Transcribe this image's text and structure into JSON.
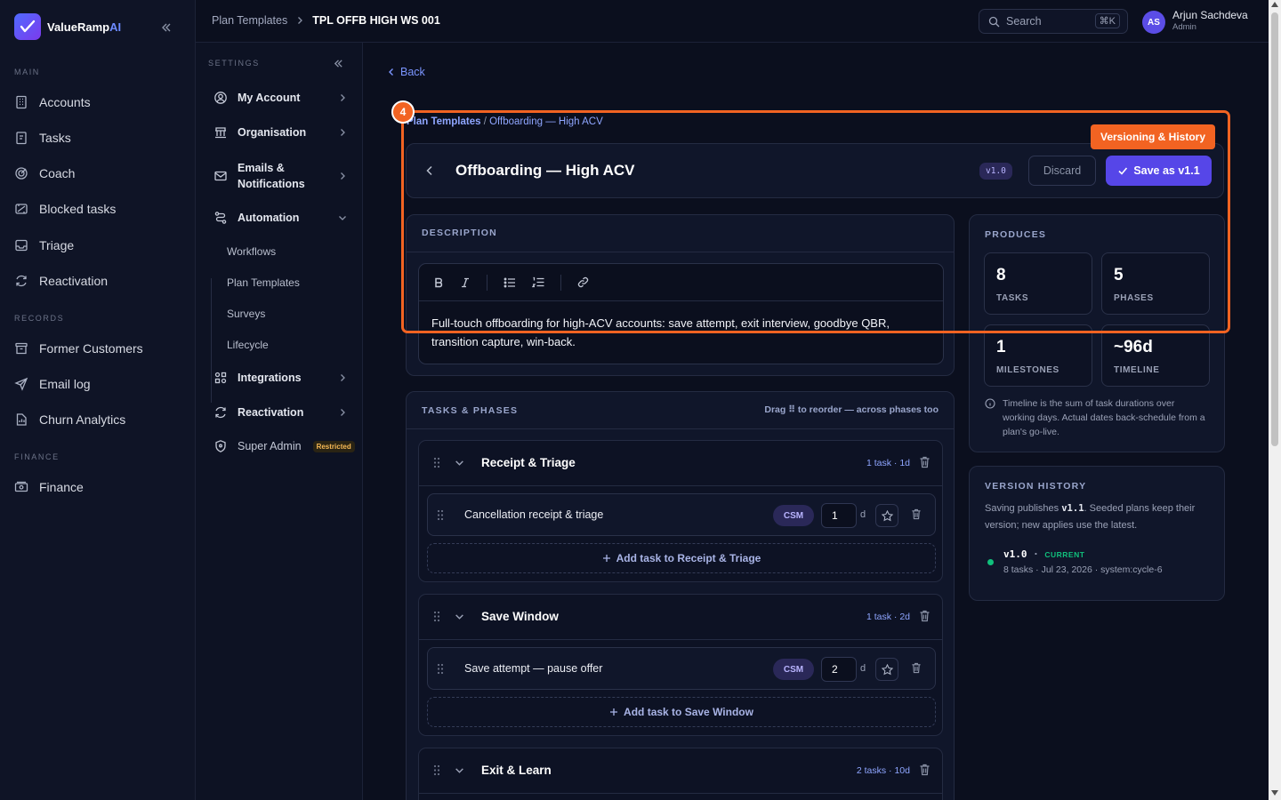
{
  "brand": {
    "name": "ValueRamp",
    "name_accent": "AI"
  },
  "nav": {
    "main_label": "MAIN",
    "main": [
      "Accounts",
      "Tasks",
      "Coach",
      "Blocked tasks",
      "Triage",
      "Reactivation"
    ],
    "records_label": "RECORDS",
    "records": [
      "Former Customers",
      "Email log",
      "Churn Analytics"
    ],
    "finance_label": "FINANCE",
    "finance": [
      "Finance"
    ]
  },
  "settings": {
    "title": "SETTINGS",
    "items": {
      "my_account": "My Account",
      "organisation": "Organisation",
      "emails_1": "Emails &",
      "emails_2": "Notifications",
      "automation": "Automation",
      "integrations": "Integrations",
      "reactivation": "Reactivation",
      "super_admin": "Super Admin",
      "restricted": "Restricted"
    },
    "automation_sub": [
      "Workflows",
      "Plan Templates",
      "Surveys",
      "Lifecycle"
    ]
  },
  "topbar": {
    "crumb1": "Plan Templates",
    "crumb2": "TPL OFFB HIGH WS 001",
    "search_placeholder": "Search",
    "search_kbd": "⌘K",
    "avatar_initials": "AS",
    "user_name": "Arjun Sachdeva",
    "user_role": "Admin"
  },
  "page": {
    "back": "Back",
    "crumb_root": "Plan Templates",
    "crumb_sep": " / ",
    "crumb_current": "Offboarding — High ACV",
    "title": "Offboarding — High ACV",
    "version": "v1.0",
    "discard": "Discard",
    "save": "Save as v1.1"
  },
  "description": {
    "label": "DESCRIPTION",
    "text": "Full-touch offboarding for high-ACV accounts: save attempt, exit interview, goodbye QBR, transition capture, win-back."
  },
  "produces": {
    "label": "PRODUCES",
    "stats": [
      {
        "value": "8",
        "label": "TASKS"
      },
      {
        "value": "5",
        "label": "PHASES"
      },
      {
        "value": "1",
        "label": "MILESTONES"
      },
      {
        "value": "~96d",
        "label": "TIMELINE"
      }
    ],
    "note": "Timeline is the sum of task durations over working days. Actual dates back-schedule from a plan's go-live."
  },
  "tasks_phases": {
    "label": "TASKS & PHASES",
    "drag_note_1": "Drag",
    "drag_note_2": "to reorder — across phases too",
    "phases": [
      {
        "title": "Receipt & Triage",
        "meta": "1 task · 1d",
        "task": {
          "name": "Cancellation receipt & triage",
          "role": "CSM",
          "duration": "1",
          "unit": "d"
        },
        "add": "Add task to Receipt & Triage"
      },
      {
        "title": "Save Window",
        "meta": "1 task · 2d",
        "task": {
          "name": "Save attempt — pause offer",
          "role": "CSM",
          "duration": "2",
          "unit": "d"
        },
        "add": "Add task to Save Window"
      },
      {
        "title": "Exit & Learn",
        "meta": "2 tasks · 10d"
      }
    ]
  },
  "version_history": {
    "label": "VERSION HISTORY",
    "text_1": "Saving publishes ",
    "text_code": "v1.1",
    "text_2": ". Seeded plans keep their version; new applies use the latest.",
    "entry": {
      "version": "v1.0",
      "sep": " · ",
      "badge": "CURRENT",
      "meta": "8 tasks · Jul 23, 2026 · system:cycle-6"
    }
  },
  "overlay": {
    "number": "4",
    "tag": "Versioning & History",
    "color": "#f26322"
  },
  "colors": {
    "accent": "#5646e8",
    "link": "#7b95ff",
    "success": "#10c07c",
    "bg": "#0b0f1e"
  }
}
